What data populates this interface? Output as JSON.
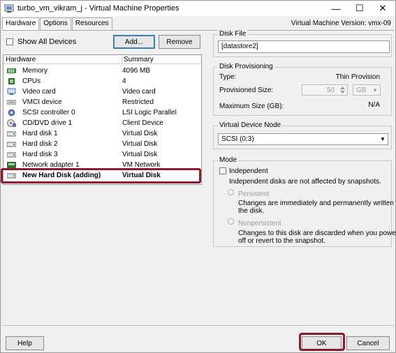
{
  "window": {
    "title": "turbo_vm_vikram_j - Virtual Machine Properties",
    "controls": {
      "minimize": "—",
      "maximize": "☐",
      "close": "✕"
    }
  },
  "tabs": [
    {
      "label": "Hardware",
      "active": true
    },
    {
      "label": "Options",
      "active": false
    },
    {
      "label": "Resources",
      "active": false
    }
  ],
  "vm_version": "Virtual Machine Version: vmx-09",
  "show_all_devices": {
    "label": "Show All Devices",
    "checked": false
  },
  "buttons": {
    "add": "Add...",
    "remove": "Remove",
    "help": "Help",
    "ok": "OK",
    "cancel": "Cancel"
  },
  "hardware": {
    "col_hardware": "Hardware",
    "col_summary": "Summary",
    "rows": [
      {
        "name": "Memory",
        "summary": "4096 MB",
        "icon": "memory-icon"
      },
      {
        "name": "CPUs",
        "summary": "4",
        "icon": "cpu-icon"
      },
      {
        "name": "Video card",
        "summary": "Video card",
        "icon": "video-card-icon"
      },
      {
        "name": "VMCI device",
        "summary": "Restricted",
        "icon": "vmci-device-icon"
      },
      {
        "name": "SCSI controller 0",
        "summary": "LSI Logic Parallel",
        "icon": "scsi-controller-icon"
      },
      {
        "name": "CD/DVD drive 1",
        "summary": "Client Device",
        "icon": "cd-dvd-icon"
      },
      {
        "name": "Hard disk 1",
        "summary": "Virtual Disk",
        "icon": "hard-disk-icon"
      },
      {
        "name": "Hard disk 2",
        "summary": "Virtual Disk",
        "icon": "hard-disk-icon"
      },
      {
        "name": "Hard disk 3",
        "summary": "Virtual Disk",
        "icon": "hard-disk-icon"
      },
      {
        "name": "Network adapter 1",
        "summary": "VM Network",
        "icon": "network-adapter-icon"
      },
      {
        "name": "New Hard Disk (adding)",
        "summary": "Virtual Disk",
        "icon": "hard-disk-icon",
        "selected": true
      }
    ]
  },
  "disk_file": {
    "title": "Disk File",
    "value": "[datastore2]"
  },
  "disk_provisioning": {
    "title": "Disk Provisioning",
    "type_label": "Type:",
    "type_value": "Thin Provision",
    "size_label": "Provisioned Size:",
    "size_value": "50",
    "size_unit": "GB",
    "max_label": "Maximum Size (GB):",
    "max_value": "N/A"
  },
  "virtual_device_node": {
    "title": "Virtual Device Node",
    "value": "SCSI (0:3)"
  },
  "mode": {
    "title": "Mode",
    "independent_label": "Independent",
    "independent_desc": "Independent disks are not affected by snapshots.",
    "persistent_label": "Persistent",
    "persistent_desc_1": "Changes are immediately and permanently written to",
    "persistent_desc_2": "the disk.",
    "nonpersistent_label": "Nonpersistent",
    "nonpersistent_desc_1": "Changes to this disk are discarded when you power",
    "nonpersistent_desc_2": "off or revert to the snapshot."
  },
  "colors": {
    "highlight": "#8b1a2b",
    "focus": "#3c7fb1"
  }
}
